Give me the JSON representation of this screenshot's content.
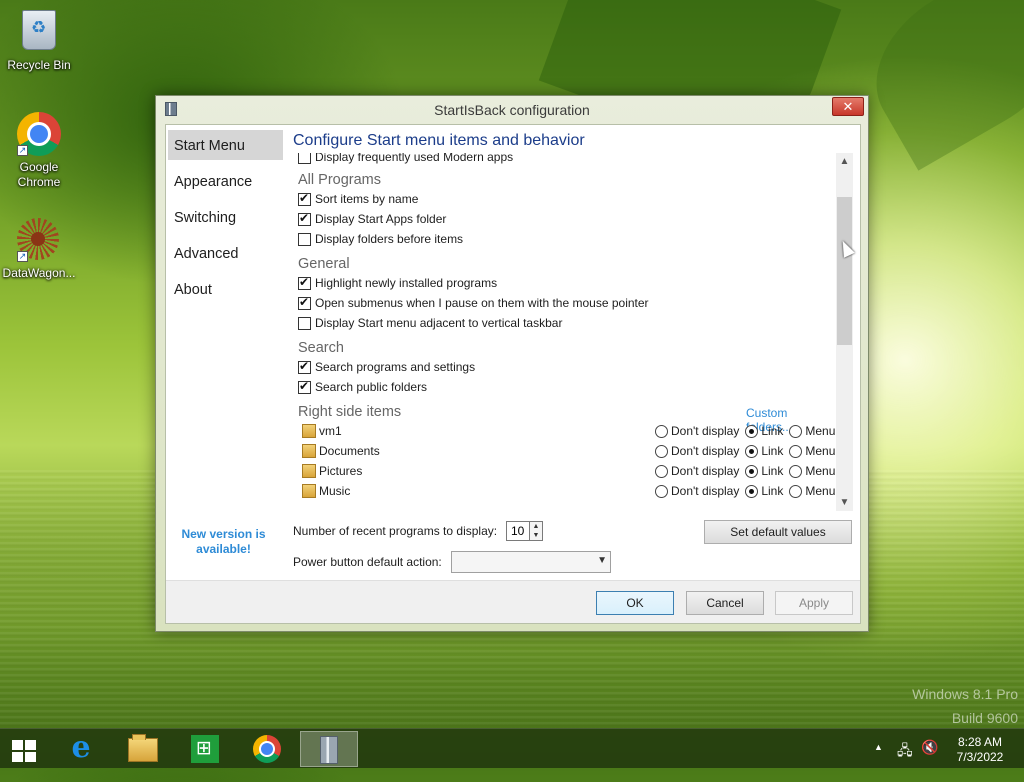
{
  "desktop": {
    "icons": [
      {
        "label": "Recycle Bin"
      },
      {
        "label": "Google Chrome"
      },
      {
        "label": "DataWagon..."
      }
    ],
    "watermark": [
      "Windows 8.1 Pro",
      "Build 9600"
    ]
  },
  "window": {
    "title": "StartIsBack configuration",
    "close_label": "✕",
    "nav": [
      {
        "label": "Start Menu",
        "selected": true
      },
      {
        "label": "Appearance",
        "selected": false
      },
      {
        "label": "Switching",
        "selected": false
      },
      {
        "label": "Advanced",
        "selected": false
      },
      {
        "label": "About",
        "selected": false
      }
    ],
    "new_version": "New version is available!",
    "heading": "Configure Start menu items and behavior",
    "top_partial_item": {
      "label": "Display frequently used Modern apps",
      "checked": false
    },
    "groups": {
      "all_programs": {
        "label": "All Programs",
        "items": [
          {
            "label": "Sort items by name",
            "checked": true
          },
          {
            "label": "Display Start Apps folder",
            "checked": true
          },
          {
            "label": "Display folders before items",
            "checked": false
          }
        ]
      },
      "general": {
        "label": "General",
        "items": [
          {
            "label": "Highlight newly installed programs",
            "checked": true
          },
          {
            "label": "Open submenus when I pause on them with the mouse pointer",
            "checked": true
          },
          {
            "label": "Display Start menu adjacent to vertical taskbar",
            "checked": false
          }
        ]
      },
      "search": {
        "label": "Search",
        "items": [
          {
            "label": "Search programs and settings",
            "checked": true
          },
          {
            "label": "Search public folders",
            "checked": true
          }
        ]
      },
      "right_side": {
        "label": "Right side items",
        "custom_link": "Custom folders...",
        "radio_labels": {
          "none": "Don't display",
          "link": "Link",
          "menu": "Menu"
        },
        "items": [
          {
            "label": "vm1",
            "selected": "link"
          },
          {
            "label": "Documents",
            "selected": "link"
          },
          {
            "label": "Pictures",
            "selected": "link"
          },
          {
            "label": "Music",
            "selected": "link"
          }
        ]
      }
    },
    "recent_label": "Number of recent programs to display:",
    "recent_value": "10",
    "set_default_label": "Set default values",
    "power_label": "Power button default action:",
    "power_value": "",
    "buttons": {
      "ok": "OK",
      "cancel": "Cancel",
      "apply": "Apply"
    }
  },
  "taskbar": {
    "clock_time": "8:28 AM",
    "clock_date": "7/3/2022"
  },
  "colors": {
    "heading": "#1c3d8a",
    "link": "#2e8bd6",
    "nav_selected": "#d6d6d6"
  }
}
